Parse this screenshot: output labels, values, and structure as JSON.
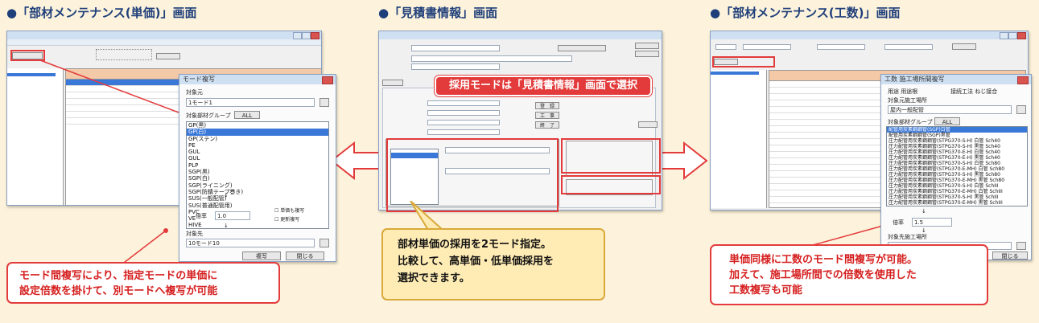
{
  "headings": {
    "left": "部材メンテナンス(単価)」画面",
    "middle": "見積書情報」画面",
    "right": "部材メンテナンス(工数)」画面",
    "left_prefix": "●「",
    "middle_prefix": "●「",
    "right_prefix": "●「"
  },
  "left_dialog": {
    "title": "モード複写",
    "source_label": "対象元",
    "source_value": "1モード1",
    "group_label": "対象部材グループ",
    "all_button": "ALL",
    "group_items": [
      "GP(黒)",
      "GP(白)",
      "GP(ステン)",
      "PE",
      "GUL",
      "GUL",
      "PLP",
      "SGP(黒)",
      "SGP(白)",
      "SGP(ライニング)",
      "SGP(防錆テープ巻き)",
      "SUS(一般配管)",
      "SUS(普通配管用)",
      "PVC",
      "VE",
      "HIVE"
    ],
    "selected_index": 1,
    "ratio_label": "倍率",
    "ratio_value": "1.0",
    "check1": "単価も複写",
    "check2": "更新複写",
    "target_label": "対象先",
    "target_value": "10モード10",
    "copy_button": "複写",
    "close_button": "閉じる"
  },
  "left_callout": {
    "line1": "モード間複写により、指定モードの単価に",
    "line2": "設定倍数を掛けて、別モードへ複写が可能"
  },
  "middle_window": {
    "title": "見積書情報",
    "banner": "採用モードは「見積書情報」画面で選択",
    "btn1": "登　録",
    "btn2": "工　事",
    "btn3": "終　了"
  },
  "middle_callout": {
    "line1": "部材単価の採用を2モード指定。",
    "line2": "比較して、高単価・低単価採用を",
    "line3": "選択できます。"
  },
  "right_dialog": {
    "title": "工数 施工場所間複写",
    "usage_label": "用途",
    "usage_value": "用途根",
    "method_label": "接続工法",
    "method_value": "ねじ接合",
    "source_place_label": "対象元施工場所",
    "source_place_value": "屋内一般配管",
    "group_label": "対象部材グループ",
    "all_button": "ALL",
    "group_items": [
      "配管用炭素鋼鋼管(SGP)白管",
      "配管用炭素鋼鋼管(SGP)黒管",
      "圧力配管用炭素鋼鋼管(STPG370-S-H) 白管 Sch40",
      "圧力配管用炭素鋼鋼管(STPG370-S-H) 黒管 Sch40",
      "圧力配管用炭素鋼鋼管(STPG370-E-H) 白管 Sch40",
      "圧力配管用炭素鋼鋼管(STPG370-E-H) 黒管 Sch40",
      "圧力配管用炭素鋼鋼管(STPG370-S-H) 白管 Sch80",
      "圧力配管用炭素鋼鋼管(STPG370-E-MH) 白管 Sch80",
      "圧力配管用炭素鋼鋼管(STPG370-S-H) 黒管 Sch80",
      "圧力配管用炭素鋼鋼管(STPG370-E-MH) 黒管 Sch80",
      "圧力配管用炭素鋼鋼管(STPG370-S-H) 白管 SchIII",
      "圧力配管用炭素鋼鋼管(STPG370-E-MH) 白管 SchIII",
      "圧力配管用炭素鋼鋼管(STPG370-S-H) 黒管 SchIII",
      "圧力配管用炭素鋼鋼管(STPG370-E-MH) 黒管 SchIII"
    ],
    "selected_index": 0,
    "ratio_label": "倍率",
    "ratio_value": "1.5",
    "target_place_label": "対象先施工場所",
    "close_button": "閉じる"
  },
  "right_callout": {
    "line1": "単価同様に工数のモード間複写が可能。",
    "line2": "加えて、施工場所間での倍数を使用した",
    "line3": "工数複写も可能"
  },
  "colors": {
    "accent_red": "#e33b3b",
    "heading_blue": "#1f3f7a",
    "selection_blue": "#3a78d8",
    "callout_yellow": "#ffecb5",
    "background": "#fdf3dc"
  }
}
